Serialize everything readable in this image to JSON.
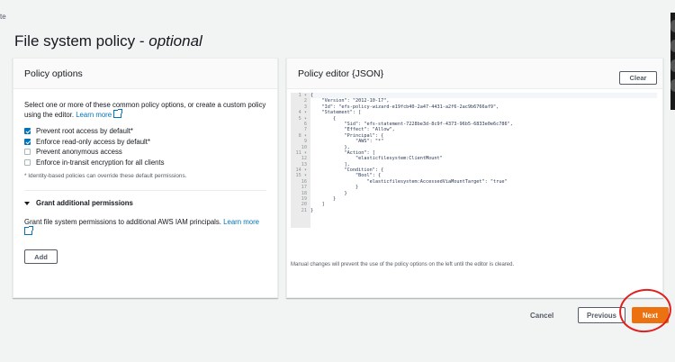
{
  "breadcrumb": "te",
  "page": {
    "title": "File system policy - ",
    "title_optional": "optional"
  },
  "left_panel": {
    "heading": "Policy options",
    "intro": "Select one or more of these common policy options, or create a custom policy using the editor. ",
    "learn_more": "Learn more",
    "options": [
      {
        "label": "Prevent root access by default*",
        "checked": true
      },
      {
        "label": "Enforce read-only access by default*",
        "checked": true
      },
      {
        "label": "Prevent anonymous access",
        "checked": false
      },
      {
        "label": "Enforce in-transit encryption for all clients",
        "checked": false
      }
    ],
    "note": "* Identity-based policies can override these default permissions.",
    "grant_heading": "Grant additional permissions",
    "grant_text": "Grant file system permissions to additional AWS IAM principals. ",
    "grant_learn_more": "Learn more",
    "add_label": "Add"
  },
  "right_panel": {
    "heading": "Policy editor {JSON}",
    "clear_label": "Clear",
    "code_lines": [
      {
        "n": "1 ▾",
        "t": "{"
      },
      {
        "n": "2",
        "t": "    \"Version\": \"2012-10-17\","
      },
      {
        "n": "3",
        "t": "    \"Id\": \"efs-policy-wizard-e19fcb40-2a47-4431-a2f6-2ac9b6766af9\","
      },
      {
        "n": "4 ▾",
        "t": "    \"Statement\": ["
      },
      {
        "n": "5 ▾",
        "t": "        {"
      },
      {
        "n": "6",
        "t": "            \"Sid\": \"efs-statement-7228be3d-8c9f-4373-96b5-6833e0e6c786\","
      },
      {
        "n": "7",
        "t": "            \"Effect\": \"Allow\","
      },
      {
        "n": "8 ▾",
        "t": "            \"Principal\": {"
      },
      {
        "n": "9",
        "t": "                \"AWS\": \"*\""
      },
      {
        "n": "10",
        "t": "            },"
      },
      {
        "n": "11 ▾",
        "t": "            \"Action\": ["
      },
      {
        "n": "12",
        "t": "                \"elasticfilesystem:ClientMount\""
      },
      {
        "n": "13",
        "t": "            ],"
      },
      {
        "n": "14 ▾",
        "t": "            \"Condition\": {"
      },
      {
        "n": "15 ▾",
        "t": "                \"Bool\": {"
      },
      {
        "n": "16",
        "t": "                    \"elasticfilesystem:AccessedViaMountTarget\": \"true\""
      },
      {
        "n": "17",
        "t": "                }"
      },
      {
        "n": "18",
        "t": "            }"
      },
      {
        "n": "19",
        "t": "        }"
      },
      {
        "n": "20",
        "t": "    ]"
      },
      {
        "n": "21",
        "t": "}"
      }
    ],
    "footnote": "Manual changes will prevent the use of the policy options on the left until the editor is cleared."
  },
  "footer": {
    "cancel_label": "Cancel",
    "previous_label": "Previous",
    "next_label": "Next"
  },
  "colors": {
    "accent": "#ec7211",
    "link": "#0073bb",
    "annotation": "#e02020"
  }
}
